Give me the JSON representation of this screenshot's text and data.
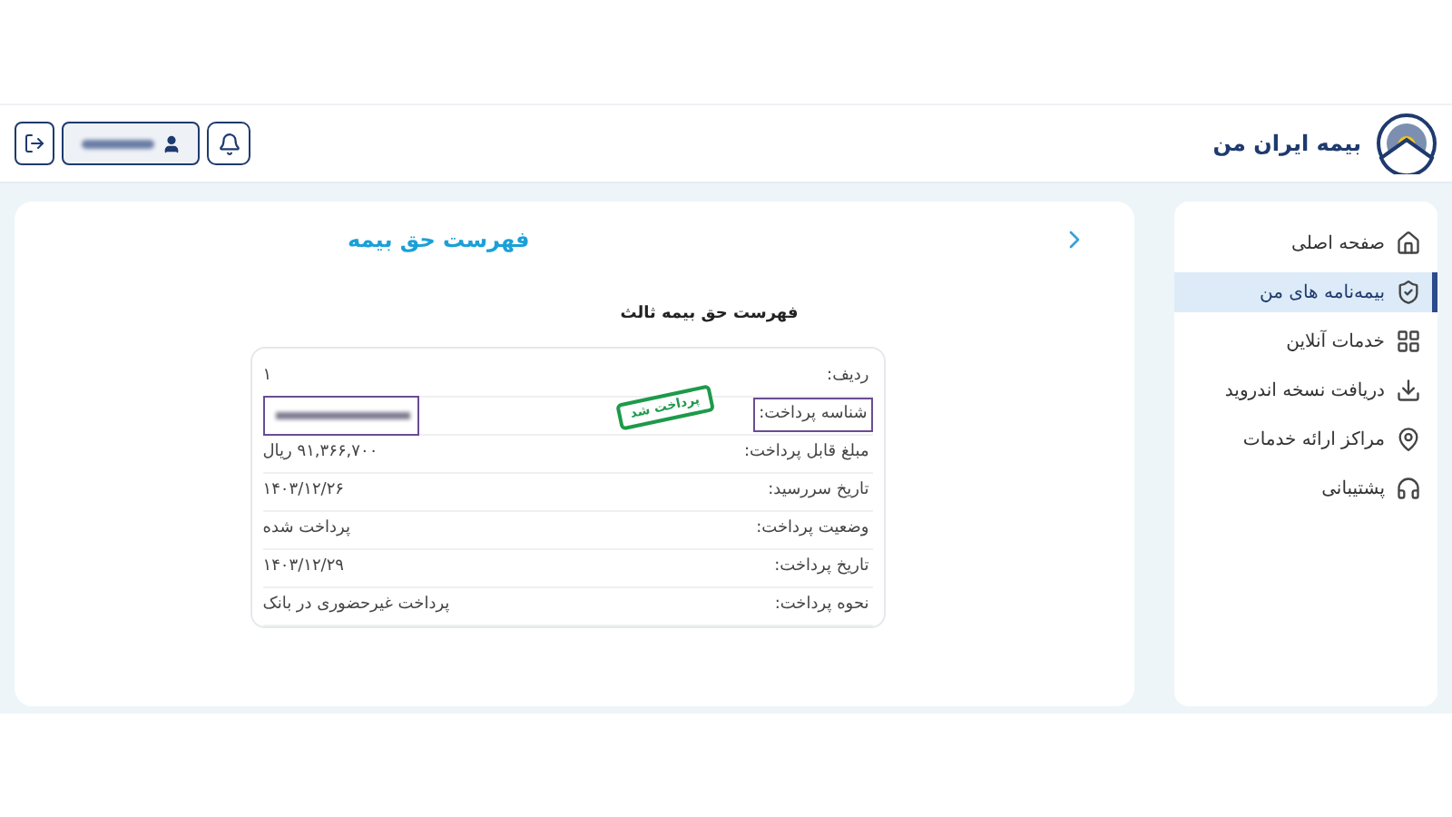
{
  "header": {
    "title": "بیمه ایران من"
  },
  "sidebar": {
    "items": [
      {
        "label": "صفحه اصلی",
        "selected": false
      },
      {
        "label": "بیمه‌نامه های من",
        "selected": true
      },
      {
        "label": "خدمات آنلاین",
        "selected": false
      },
      {
        "label": "دریافت نسخه اندروید",
        "selected": false
      },
      {
        "label": "مراکز ارائه خدمات",
        "selected": false
      },
      {
        "label": "پشتیبانی",
        "selected": false
      }
    ]
  },
  "page": {
    "title": "فهرست حق بیمه",
    "subtitle": "فهرست حق بیمه ثالث"
  },
  "details": {
    "stamp": "پرداخت شد",
    "rows": [
      {
        "label": "ردیف:",
        "value": "۱",
        "kind": "text",
        "highlighted": false
      },
      {
        "label": "شناسه پرداخت:",
        "kind": "blurred",
        "highlighted": true
      },
      {
        "label": "مبلغ قابل پرداخت:",
        "value": "۹۱,۳۶۶,۷۰۰ ریال",
        "kind": "text",
        "highlighted": false
      },
      {
        "label": "تاریخ سررسید:",
        "value": "۱۴۰۳/۱۲/۲۶",
        "kind": "text",
        "highlighted": false
      },
      {
        "label": "وضعیت پرداخت:",
        "value": "پرداخت شده",
        "kind": "text",
        "highlighted": false
      },
      {
        "label": "تاریخ پرداخت:",
        "value": "۱۴۰۳/۱۲/۲۹",
        "kind": "text",
        "highlighted": false
      },
      {
        "label": "نحوه پرداخت:",
        "value": "پرداخت غیرحضوری در بانک",
        "kind": "text",
        "highlighted": false
      }
    ]
  }
}
